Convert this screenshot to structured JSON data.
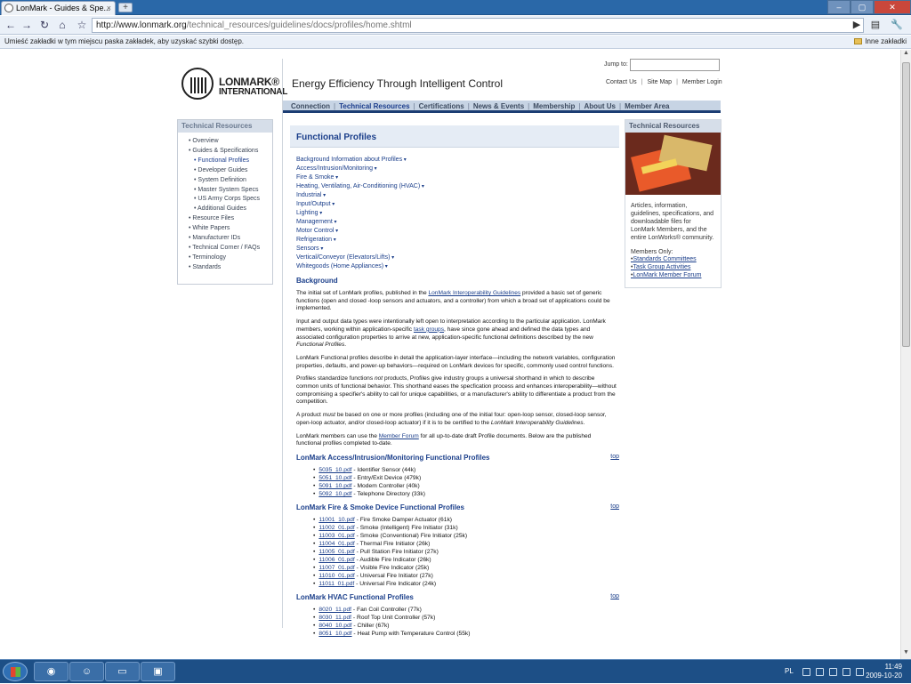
{
  "browser": {
    "tab_title": "LonMark - Guides & Spe...",
    "tab_close": "×",
    "new_tab": "+",
    "url_host": "http://www.lonmark.org",
    "url_path": "/technical_resources/guidelines/docs/profiles/home.shtml",
    "bookmarks_hint": "Umieść zakładki w tym miejscu paska zakładek, aby uzyskać szybki dostęp.",
    "other_bookmarks": "Inne zakładki"
  },
  "site": {
    "logo_line1": "LONMARK®",
    "logo_line2": "INTERNATIONAL",
    "tagline": "Energy Efficiency Through Intelligent Control",
    "jump_label": "Jump to:",
    "toplinks": [
      "Contact Us",
      "Site Map",
      "Member Login"
    ],
    "nav": [
      "Connection",
      "Technical Resources",
      "Certifications",
      "News & Events",
      "Membership",
      "About Us",
      "Member Area"
    ]
  },
  "sidebar": {
    "title": "Technical Resources",
    "items": [
      {
        "label": "Overview",
        "sub": false
      },
      {
        "label": "Guides & Specifications",
        "sub": false
      },
      {
        "label": "Functional Profiles",
        "sub": true,
        "current": true
      },
      {
        "label": "Developer Guides",
        "sub": true
      },
      {
        "label": "System Definition",
        "sub": true
      },
      {
        "label": "Master System Specs",
        "sub": true
      },
      {
        "label": "US Army Corps Specs",
        "sub": true
      },
      {
        "label": "Additional Guides",
        "sub": true
      },
      {
        "label": "Resource Files",
        "sub": false
      },
      {
        "label": "White Papers",
        "sub": false
      },
      {
        "label": "Manufacturer IDs",
        "sub": false
      },
      {
        "label": "Technical Corner / FAQs",
        "sub": false
      },
      {
        "label": "Terminology",
        "sub": false
      },
      {
        "label": "Standards",
        "sub": false
      }
    ]
  },
  "main": {
    "title": "Functional Profiles",
    "jump_links": [
      "Background Information about Profiles",
      "Access/Intrusion/Monitoring",
      "Fire & Smoke",
      "Heating, Ventilating, Air-Conditioning (HVAC)",
      "Industrial",
      "Input/Output",
      "Lighting",
      "Management",
      "Motor Control",
      "Refrigeration",
      "Sensors",
      "Vertical/Conveyor (Elevators/Lifts)",
      "Whitegoods (Home Appliances)"
    ],
    "background_heading": "Background",
    "p1_a": "The initial set of LonMark profiles, published in the ",
    "p1_link": "LonMark Interoperability Guidelines",
    "p1_b": " provided a basic set of generic functions (open and closed -loop sensors and actuators, and a controller) from which a broad set of applications could be implemented.",
    "p2_a": "Input and output data types were intentionally left open to interpretation according to the particular application. LonMark members, working within application-specific ",
    "p2_link": "task groups",
    "p2_b": ", have since gone ahead and defined the data types and associated configuration properties to arrive at new, application-specific functional definitions described by the new ",
    "p2_i": "Functional Profiles",
    "p2_c": ".",
    "p3": "LonMark Functional profiles describe in detail the application-layer interface—including the network variables, configuration properties, defaults, and power-up behaviors—required on LonMark devices for specific, commonly used control functions.",
    "p4_a": "Profiles standardize functions ",
    "p4_i": "not",
    "p4_b": " products, Profiles give industry groups a universal shorthand in which to describe common units of functional behavior. This shorthand eases the specfication process and enhances interoperability—without compromising a specifier's ability to call for unique capabilities, or a manufacturer's ability to differentiate a product from the competition.",
    "p5_a": "A product ",
    "p5_i": "must",
    "p5_b": " be based on one or more profiles (including one of the initial four: open-loop sensor, closed-loop sensor, open-loop actuator, and/or closed-loop actuator) if it is to be certified to the ",
    "p5_i2": "LonMark Interoperability Guidelines",
    "p5_c": ".",
    "p6_a": "LonMark members can use the ",
    "p6_link": "Member Forum",
    "p6_b": " for all up-to-date draft Profile documents. Below are the published functional profiles completed to-date.",
    "top_label": "top",
    "sections": [
      {
        "heading": "LonMark Access/Intrusion/Monitoring Functional Profiles",
        "files": [
          {
            "file": "5035_10.pdf",
            "desc": " - Identifier Sensor (44k)"
          },
          {
            "file": "5051_10.pdf",
            "desc": " - Entry/Exit Device (479k)"
          },
          {
            "file": "5091_10.pdf",
            "desc": " - Modem Controller (40k)"
          },
          {
            "file": "5092_10.pdf",
            "desc": " - Telephone Directory (33k)"
          }
        ]
      },
      {
        "heading": "LonMark Fire & Smoke Device Functional Profiles",
        "files": [
          {
            "file": "11001_10.pdf",
            "desc": " - Fire Smoke Damper Actuator (61k)"
          },
          {
            "file": "11002_01.pdf",
            "desc": " - Smoke (Intelligent) Fire Initiator (31k)"
          },
          {
            "file": "11003_01.pdf",
            "desc": " - Smoke (Conventional) Fire Initiator (25k)"
          },
          {
            "file": "11004_01.pdf",
            "desc": " - Thermal Fire Initiator (26k)"
          },
          {
            "file": "11005_01.pdf",
            "desc": " - Pull Station Fire Initiator (27k)"
          },
          {
            "file": "11006_01.pdf",
            "desc": " - Audible Fire Indicator (26k)"
          },
          {
            "file": "11007_01.pdf",
            "desc": " - Visible Fire Indicator (25k)"
          },
          {
            "file": "11010_01.pdf",
            "desc": " - Universal Fire Initiator (27k)"
          },
          {
            "file": "11011_01.pdf",
            "desc": " - Universal Fire Indicator (24k)"
          }
        ]
      },
      {
        "heading": "LonMark HVAC Functional Profiles",
        "files": [
          {
            "file": "8020_11.pdf",
            "desc": " - Fan Coil Controller (77k)"
          },
          {
            "file": "8030_11.pdf",
            "desc": " - Roof Top Unit Controller (57k)"
          },
          {
            "file": "8040_10.pdf",
            "desc": " - Chiller (67k)"
          },
          {
            "file": "8051_10.pdf",
            "desc": " - Heat Pump with Temperature Control (55k)"
          }
        ]
      }
    ]
  },
  "rhs": {
    "title": "Technical Resources",
    "text": "Articles, information, guidelines, specifications, and downloadable files for LonMark Members, and the entire LonWorks® community.",
    "members_only": "Members Only:",
    "links": [
      "Standards Committees",
      "Task Group Activities",
      "LonMark Member Forum"
    ]
  },
  "taskbar": {
    "lang": "PL",
    "time": "11:49",
    "date": "2009-10-20"
  }
}
